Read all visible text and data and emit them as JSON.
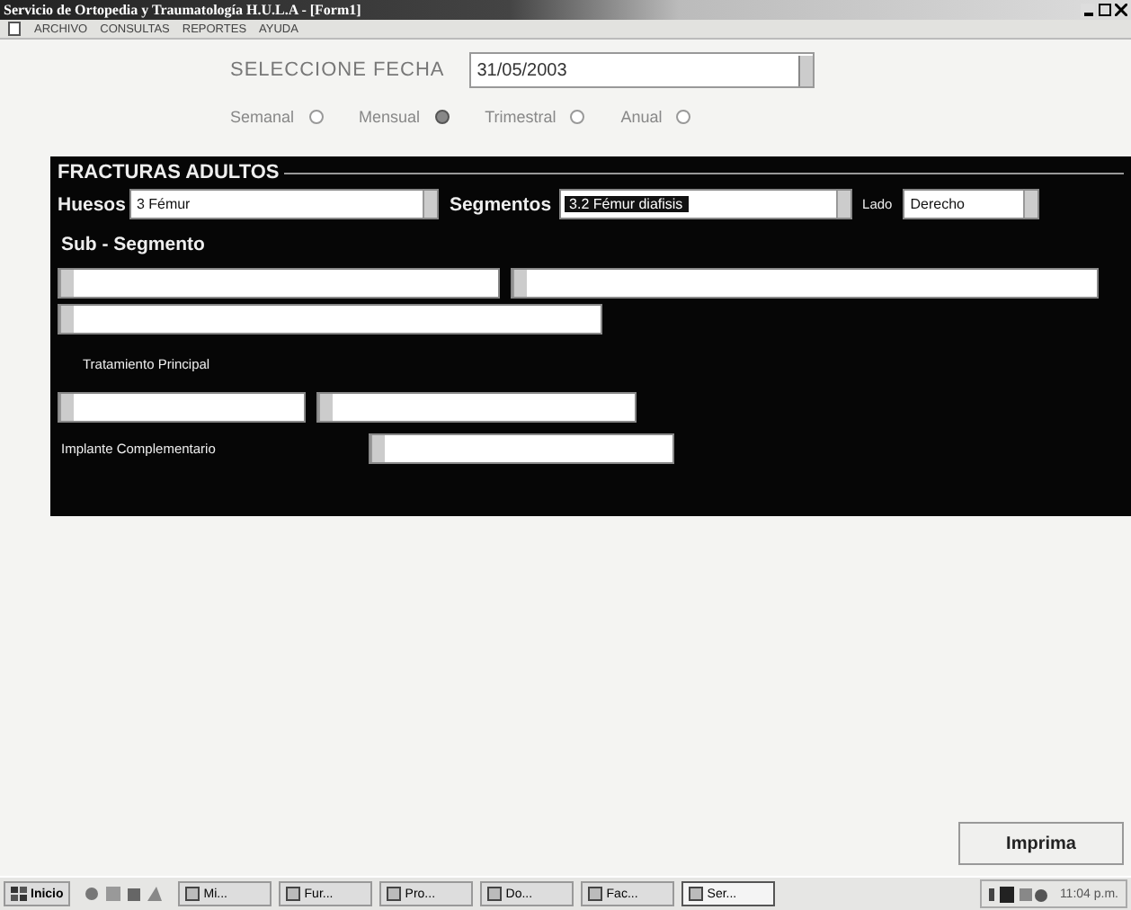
{
  "window": {
    "title": "Servicio de Ortopedia y Traumatología H.U.L.A - [Form1]"
  },
  "menu": [
    "ARCHIVO",
    "CONSULTAS",
    "REPORTES",
    "AYUDA"
  ],
  "date": {
    "label": "SELECCIONE FECHA",
    "value": "31/05/2003"
  },
  "period_options": [
    {
      "label": "Semanal",
      "selected": false
    },
    {
      "label": "Mensual",
      "selected": true
    },
    {
      "label": "Trimestral",
      "selected": false
    },
    {
      "label": "Anual",
      "selected": false
    }
  ],
  "panel": {
    "title": "FRACTURAS ADULTOS",
    "huesos": {
      "label": "Huesos",
      "value": "3 Fémur"
    },
    "segmentos": {
      "label": "Segmentos",
      "value": "3.2 Fémur diafisis",
      "highlighted": true
    },
    "lado": {
      "label": "Lado",
      "value": "Derecho"
    },
    "sub_segmento_label": "Sub - Segmento",
    "tratamiento_label": "Tratamiento Principal",
    "implante_label": "Implante Complementario"
  },
  "print_button": "Imprima",
  "taskbar": {
    "start": "Inicio",
    "tasks": [
      {
        "label": "Mi...",
        "selected": false
      },
      {
        "label": "Fur...",
        "selected": false
      },
      {
        "label": "Pro...",
        "selected": false
      },
      {
        "label": "Do...",
        "selected": false
      },
      {
        "label": "Fac...",
        "selected": false
      },
      {
        "label": "Ser...",
        "selected": true
      }
    ],
    "clock": "11:04 p.m."
  }
}
